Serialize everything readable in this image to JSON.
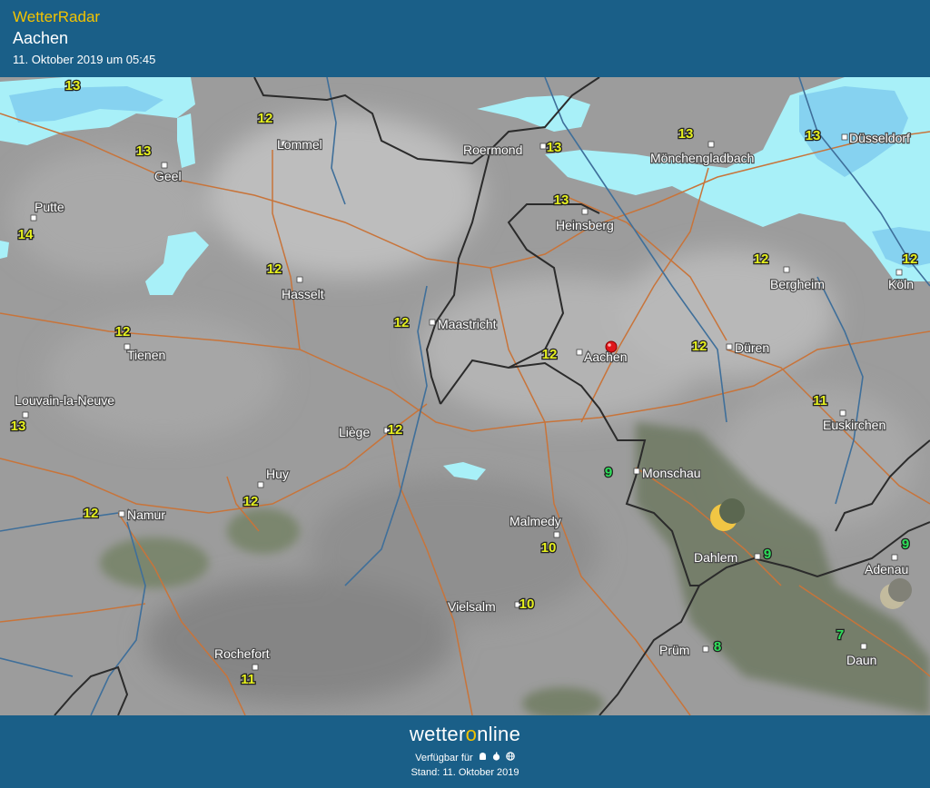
{
  "header": {
    "app_title": "WetterRadar",
    "location": "Aachen",
    "timestamp": "11. Oktober 2019 um 05:45"
  },
  "map": {
    "towns": [
      {
        "name": "Lommel",
        "temp": "12"
      },
      {
        "name": "Roermond",
        "temp": "13"
      },
      {
        "name": "Mönchengladbach",
        "temp": "13"
      },
      {
        "name": "Düsseldorf",
        "temp": "13"
      },
      {
        "name": "Geel",
        "temp": "13"
      },
      {
        "name": "Heinsberg",
        "temp": "13"
      },
      {
        "name": "Putte",
        "temp": "14"
      },
      {
        "name": "Hasselt",
        "temp": "12"
      },
      {
        "name": "Bergheim",
        "temp": "12"
      },
      {
        "name": "Köln",
        "temp": "12"
      },
      {
        "name": "Maastricht",
        "temp": "12"
      },
      {
        "name": "Tienen",
        "temp": "12"
      },
      {
        "name": "Aachen",
        "temp": "12"
      },
      {
        "name": "Düren",
        "temp": "12"
      },
      {
        "name": "Louvain-la-Neuve",
        "temp": "13"
      },
      {
        "name": "Euskirchen",
        "temp": "11"
      },
      {
        "name": "Liège",
        "temp": "12"
      },
      {
        "name": "Monschau",
        "temp": "9"
      },
      {
        "name": "Huy",
        "temp": "12"
      },
      {
        "name": "Namur",
        "temp": "12"
      },
      {
        "name": "Malmedy",
        "temp": "10"
      },
      {
        "name": "Dahlem",
        "temp": "9"
      },
      {
        "name": "Adenau",
        "temp": "9"
      },
      {
        "name": "Vielsalm",
        "temp": "10"
      },
      {
        "name": "Daun",
        "temp": "7"
      },
      {
        "name": "Prüm",
        "temp": "8"
      },
      {
        "name": "Rochefort",
        "temp": "11"
      }
    ],
    "unlabeled_temps": [
      "13"
    ],
    "colors": {
      "temp_warm": "#e6f01e",
      "temp_cool": "#2ee05a",
      "rain": "#a8f0f8",
      "rain_heavy": "#86d2f0",
      "border": "#2b2b2b",
      "road": "#c8743a",
      "river": "#3f6f9a",
      "forest": "#6f7f5e",
      "location_pin": "#e0161b"
    },
    "icons": [
      "moon-icon",
      "location-pin-icon"
    ]
  },
  "footer": {
    "brand_prefix": "wetter",
    "brand_o": "o",
    "brand_suffix": "nline",
    "available_label": "Verfügbar für",
    "platform_icons": [
      "android-icon",
      "apple-icon",
      "web-icon"
    ],
    "stand": "Stand: 11. Oktober 2019"
  }
}
